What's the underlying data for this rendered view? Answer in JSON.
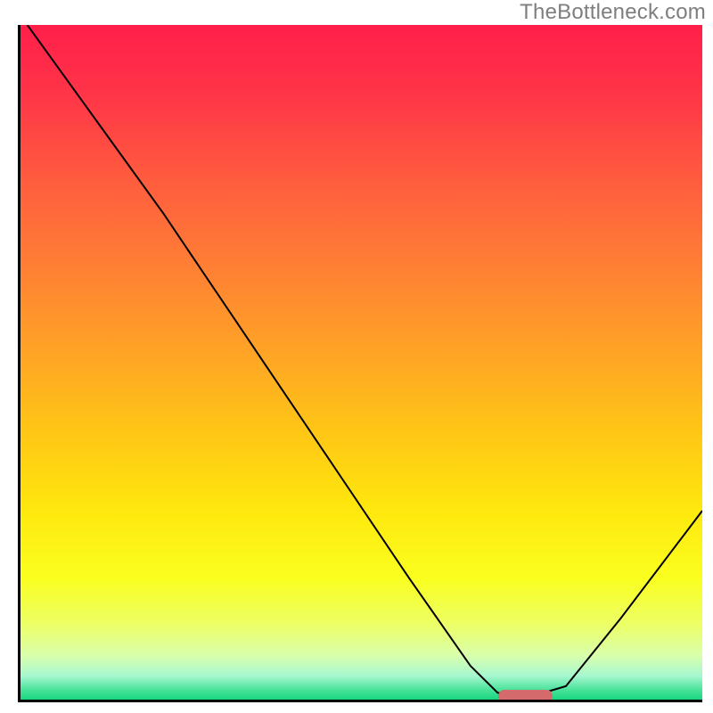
{
  "watermark": "TheBottleneck.com",
  "chart_data": {
    "type": "line",
    "title": "",
    "xlabel": "",
    "ylabel": "",
    "xlim": [
      0,
      100
    ],
    "ylim": [
      0,
      100
    ],
    "grid": false,
    "legend": false,
    "gradient_stops": [
      {
        "offset": 0.0,
        "color": "#ff1f4a"
      },
      {
        "offset": 0.1,
        "color": "#ff3448"
      },
      {
        "offset": 0.22,
        "color": "#ff593f"
      },
      {
        "offset": 0.35,
        "color": "#ff7d35"
      },
      {
        "offset": 0.48,
        "color": "#ffa226"
      },
      {
        "offset": 0.6,
        "color": "#ffc516"
      },
      {
        "offset": 0.72,
        "color": "#ffe80d"
      },
      {
        "offset": 0.82,
        "color": "#faff1f"
      },
      {
        "offset": 0.89,
        "color": "#ecff68"
      },
      {
        "offset": 0.935,
        "color": "#d9ffad"
      },
      {
        "offset": 0.965,
        "color": "#a6f7cf"
      },
      {
        "offset": 0.985,
        "color": "#4be39b"
      },
      {
        "offset": 1.0,
        "color": "#18d77f"
      }
    ],
    "series": [
      {
        "name": "bottleneck-curve",
        "points_pct": [
          {
            "x": 1.0,
            "y": 100.0
          },
          {
            "x": 11.0,
            "y": 86.0
          },
          {
            "x": 21.0,
            "y": 72.0
          },
          {
            "x": 25.0,
            "y": 66.0
          },
          {
            "x": 33.0,
            "y": 54.0
          },
          {
            "x": 45.0,
            "y": 36.0
          },
          {
            "x": 57.0,
            "y": 18.0
          },
          {
            "x": 66.0,
            "y": 5.0
          },
          {
            "x": 70.0,
            "y": 1.0
          },
          {
            "x": 75.0,
            "y": 0.5
          },
          {
            "x": 80.0,
            "y": 2.0
          },
          {
            "x": 88.0,
            "y": 12.0
          },
          {
            "x": 100.0,
            "y": 28.0
          }
        ]
      }
    ],
    "optimal_marker": {
      "x_start_pct": 70.0,
      "x_end_pct": 78.0,
      "y_pct": 0.6,
      "color": "#d56a6d"
    }
  }
}
